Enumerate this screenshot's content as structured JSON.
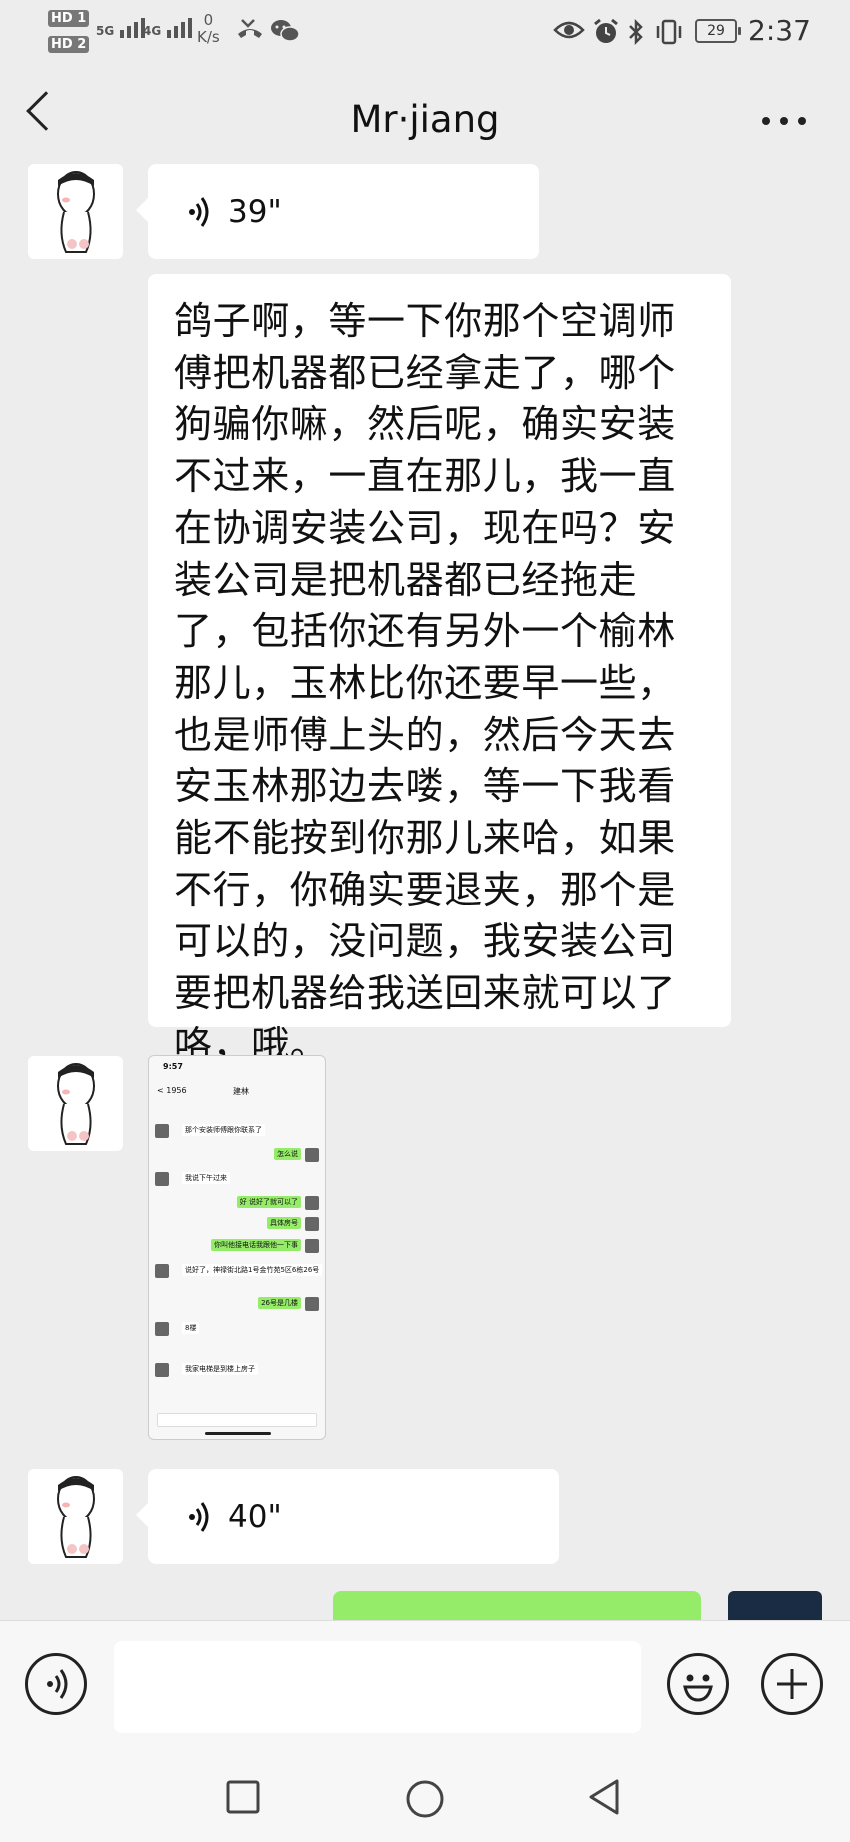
{
  "status_bar": {
    "hd1": "HD 1",
    "hd2": "HD 2",
    "net_5g": "5G",
    "net_4g": "4G",
    "speed_value": "0",
    "speed_unit": "K/s",
    "battery": "29",
    "time": "2:37"
  },
  "header": {
    "title": "Mr·jiang",
    "back_icon": "chevron-left-icon",
    "more_icon": "more-dots-icon"
  },
  "messages": [
    {
      "type": "voice",
      "duration": "39\""
    },
    {
      "type": "text",
      "text": "鸽子啊，等一下你那个空调师傅把机器都已经拿走了，哪个狗骗你嘛，然后呢，确实安装不过来，一直在那儿，我一直在协调安装公司，现在吗？安装公司是把机器都已经拖走了，包括你还有另外一个榆林那儿，玉林比你还要早一些，也是师傅上头的，然后今天去安玉林那边去喽，等一下我看能不能按到你那儿来哈，如果不行，你确实要退夹，那个是可以的，没问题，我安装公司要把机器给我送回来就可以了咯，哦。"
    },
    {
      "type": "image",
      "description": "chat screenshot",
      "inner": {
        "time": "9:57",
        "back": "< 1956",
        "name": "建林",
        "rows": [
          {
            "side": "left",
            "text": "那个安装师傅跟你联系了"
          },
          {
            "side": "right",
            "text": "怎么说"
          },
          {
            "side": "left",
            "text": "我说下午过来"
          },
          {
            "side": "right",
            "text": "好 说好了就可以了"
          },
          {
            "side": "right",
            "text": "具体房号"
          },
          {
            "side": "right",
            "text": "你叫他接电话我跟他一下事"
          },
          {
            "side": "left",
            "text": "说好了，神禄街北路1号金竹苑5区6栋26号"
          },
          {
            "side": "right",
            "text": "26号是几楼"
          },
          {
            "side": "left",
            "text": "8楼"
          },
          {
            "side": "left",
            "text": "我家电梯是到楼上房子"
          }
        ]
      }
    },
    {
      "type": "voice",
      "duration": "40\""
    }
  ],
  "input_bar": {
    "voice_icon": "voice-input-icon",
    "emoji_icon": "emoji-icon",
    "plus_icon": "plus-icon"
  },
  "nav_bar": {
    "recent_icon": "square-recent-icon",
    "home_icon": "circle-home-icon",
    "back_icon": "triangle-back-icon"
  }
}
